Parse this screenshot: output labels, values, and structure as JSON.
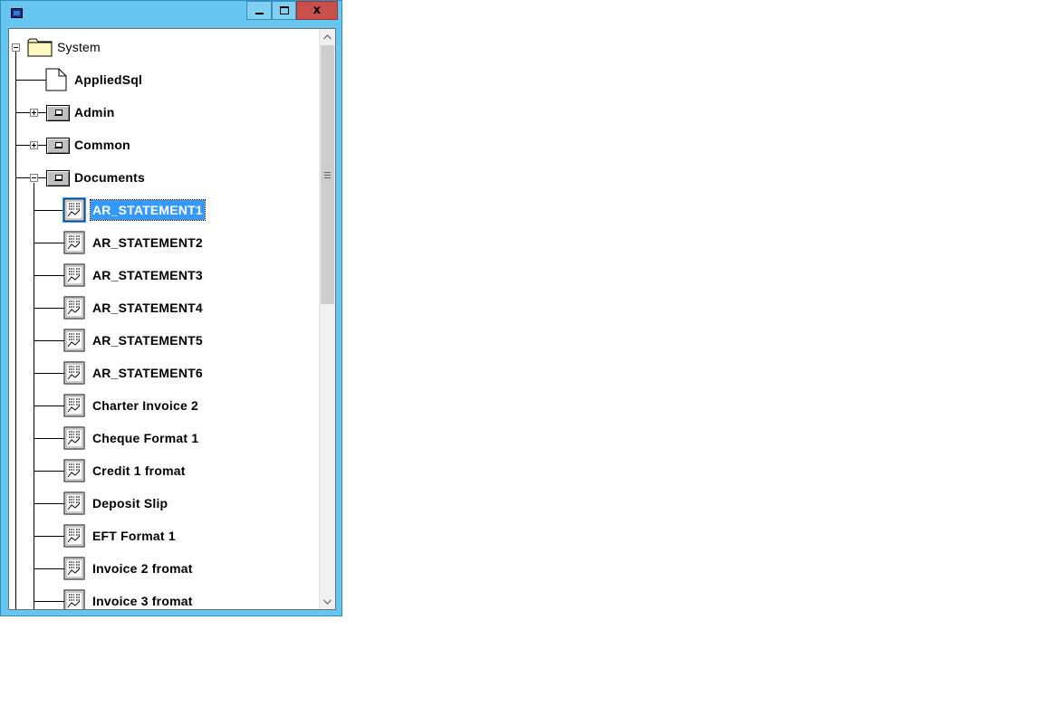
{
  "window": {
    "title": "",
    "close_glyph": "x",
    "colors": {
      "frame": "#66c6ef",
      "close": "#c7504b",
      "selection": "#3399ff"
    }
  },
  "tree": {
    "root": {
      "label": "System",
      "icon": "folder-icon",
      "expanded": true
    },
    "children": [
      {
        "label": "AppliedSql",
        "icon": "page-icon",
        "expander": "none"
      },
      {
        "label": "Admin",
        "icon": "module-icon",
        "expander": "plus"
      },
      {
        "label": "Common",
        "icon": "module-icon",
        "expander": "plus"
      },
      {
        "label": "Documents",
        "icon": "module-icon",
        "expander": "minus"
      }
    ],
    "documents": [
      {
        "label": "AR_STATEMENT1",
        "selected": true
      },
      {
        "label": "AR_STATEMENT2"
      },
      {
        "label": "AR_STATEMENT3"
      },
      {
        "label": "AR_STATEMENT4"
      },
      {
        "label": "AR_STATEMENT5"
      },
      {
        "label": "AR_STATEMENT6"
      },
      {
        "label": "Charter Invoice 2"
      },
      {
        "label": "Cheque Format 1"
      },
      {
        "label": "Credit 1 fromat"
      },
      {
        "label": "Deposit Slip"
      },
      {
        "label": "EFT Format 1"
      },
      {
        "label": "Invoice 2 fromat"
      },
      {
        "label": "Invoice 3 fromat"
      }
    ]
  }
}
